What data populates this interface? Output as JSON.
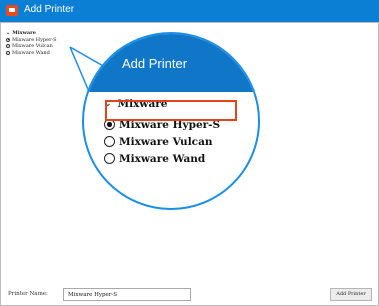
{
  "window": {
    "title": "Add Printer"
  },
  "small_tree": {
    "header": "Mixware",
    "items": [
      {
        "label": "Mixware Hyper-S",
        "selected": true
      },
      {
        "label": "Mixware Vulcan",
        "selected": false
      },
      {
        "label": "Mixware Wand",
        "selected": false
      }
    ]
  },
  "magnifier": {
    "banner_title": "Add Printer",
    "header": "Mixware",
    "items": [
      {
        "label": "Mixware Hyper-S",
        "selected": true
      },
      {
        "label": "Mixware Vulcan",
        "selected": false
      },
      {
        "label": "Mixware Wand",
        "selected": false
      }
    ],
    "highlight_color": "#e0461e",
    "circle_color": "#1a8ee6"
  },
  "footer": {
    "printer_name_label": "Printer Name:",
    "printer_name_value": "Mixware Hyper-S",
    "add_button": "Add Printer"
  },
  "colors": {
    "titlebar": "#0a7fd4",
    "banner": "#1076c8"
  }
}
